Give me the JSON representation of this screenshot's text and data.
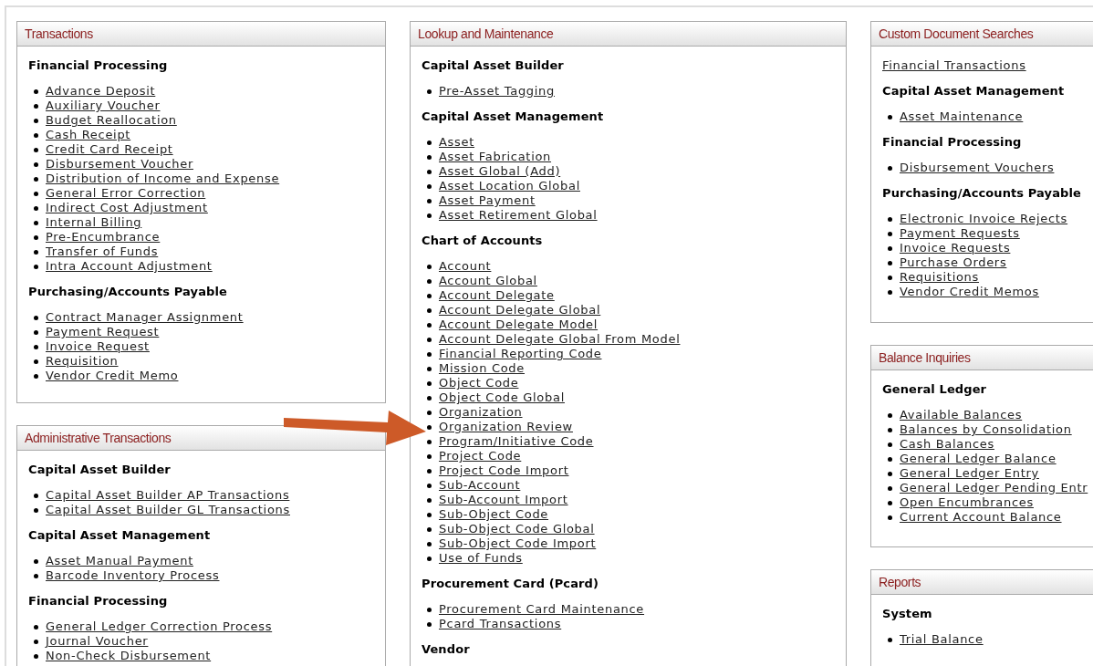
{
  "columns": [
    {
      "panels": [
        {
          "title": "Transactions",
          "blocks": [
            {
              "kind": "section",
              "heading": "Financial Processing",
              "links": [
                "Advance Deposit",
                "Auxiliary Voucher",
                "Budget Reallocation",
                "Cash Receipt",
                "Credit Card Receipt",
                "Disbursement Voucher",
                "Distribution of Income and Expense",
                "General Error Correction",
                "Indirect Cost Adjustment",
                "Internal Billing",
                "Pre-Encumbrance",
                "Transfer of Funds",
                "Intra Account Adjustment"
              ]
            },
            {
              "kind": "section",
              "heading": "Purchasing/Accounts Payable",
              "links": [
                "Contract Manager Assignment",
                "Payment Request",
                "Invoice Request",
                "Requisition",
                "Vendor Credit Memo"
              ]
            }
          ]
        },
        {
          "title": "Administrative Transactions",
          "blocks": [
            {
              "kind": "section",
              "heading": "Capital Asset Builder",
              "links": [
                "Capital Asset Builder AP Transactions",
                "Capital Asset Builder GL Transactions"
              ]
            },
            {
              "kind": "section",
              "heading": "Capital Asset Management",
              "links": [
                "Asset Manual Payment",
                "Barcode Inventory Process"
              ]
            },
            {
              "kind": "section",
              "heading": "Financial Processing",
              "links": [
                "General Ledger Correction Process",
                "Journal Voucher",
                "Non-Check Disbursement"
              ]
            }
          ]
        }
      ]
    },
    {
      "panels": [
        {
          "title": "Lookup and Maintenance",
          "blocks": [
            {
              "kind": "section",
              "heading": "Capital Asset Builder",
              "links": [
                "Pre-Asset Tagging"
              ]
            },
            {
              "kind": "section",
              "heading": "Capital Asset Management",
              "links": [
                "Asset",
                "Asset Fabrication",
                "Asset Global (Add)",
                "Asset Location Global",
                "Asset Payment",
                "Asset Retirement Global"
              ]
            },
            {
              "kind": "section",
              "heading": "Chart of Accounts",
              "links": [
                "Account",
                "Account Global",
                "Account Delegate",
                "Account Delegate Global",
                "Account Delegate Model",
                "Account Delegate Global From Model",
                "Financial Reporting Code",
                "Mission Code",
                "Object Code",
                "Object Code Global",
                "Organization",
                "Organization Review",
                "Program/Initiative Code",
                "Project Code",
                "Project Code Import",
                "Sub-Account",
                "Sub-Account Import",
                "Sub-Object Code",
                "Sub-Object Code Global",
                "Sub-Object Code Import",
                "Use of Funds"
              ]
            },
            {
              "kind": "section",
              "heading": "Procurement Card (Pcard)",
              "links": [
                "Procurement Card Maintenance",
                "Pcard Transactions"
              ]
            },
            {
              "kind": "section",
              "heading": "Vendor"
            }
          ]
        }
      ]
    },
    {
      "panels": [
        {
          "title": "Custom Document Searches",
          "blocks": [
            {
              "kind": "link",
              "text": "Financial Transactions"
            },
            {
              "kind": "section",
              "heading": "Capital Asset Management",
              "links": [
                "Asset Maintenance"
              ]
            },
            {
              "kind": "section",
              "heading": "Financial Processing",
              "links": [
                "Disbursement Vouchers"
              ]
            },
            {
              "kind": "section",
              "heading": "Purchasing/Accounts Payable",
              "links": [
                "Electronic Invoice Rejects",
                "Payment Requests",
                "Invoice Requests",
                "Purchase Orders",
                "Requisitions",
                "Vendor Credit Memos"
              ]
            }
          ]
        },
        {
          "title": "Balance Inquiries",
          "blocks": [
            {
              "kind": "section",
              "heading": "General Ledger",
              "links": [
                "Available Balances",
                "Balances by Consolidation",
                "Cash Balances",
                "General Ledger Balance",
                "General Ledger Entry",
                "General Ledger Pending Entr",
                "Open Encumbrances",
                "Current Account Balance"
              ]
            }
          ]
        },
        {
          "title": "Reports",
          "blocks": [
            {
              "kind": "section",
              "heading": "System",
              "links": [
                "Trial Balance"
              ]
            }
          ]
        }
      ]
    }
  ]
}
